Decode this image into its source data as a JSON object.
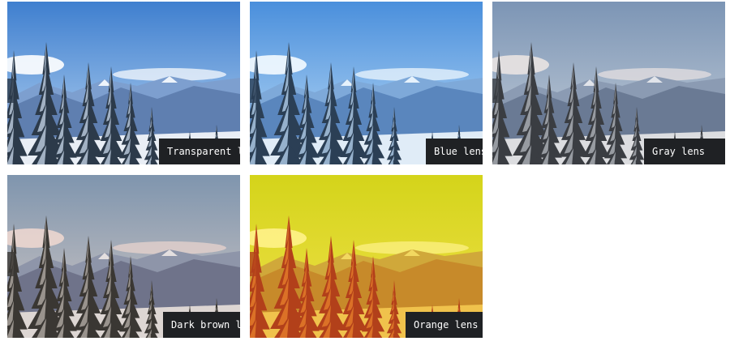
{
  "panels": [
    {
      "label": "Transparent lens",
      "tint": "transparent"
    },
    {
      "label": "Blue lens",
      "tint": "blue"
    },
    {
      "label": "Gray lens",
      "tint": "gray"
    },
    {
      "label": "Dark brown lens",
      "tint": "dark-brown"
    },
    {
      "label": "Orange lens",
      "tint": "orange"
    }
  ],
  "colors": {
    "label_bg": "#1f2124",
    "label_text": "#ffffff",
    "sky_transparent": "#5a8fd0",
    "sky_blue": "#5a98d8",
    "sky_gray": "#8aa2bf",
    "sky_dark_brown": "#8fa4bb",
    "sky_orange": "#d8d827"
  }
}
